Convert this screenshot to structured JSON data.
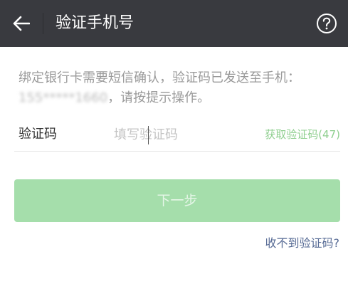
{
  "header": {
    "title": "验证手机号",
    "back_icon": "arrow-left-icon",
    "help_icon": "question-circle-icon"
  },
  "notice": {
    "text_prefix": "绑定银行卡需要短信确认，验证码已发送至手机：",
    "phone": "155*****1660",
    "text_suffix": "，请按提示操作。"
  },
  "code_field": {
    "label": "验证码",
    "placeholder": "填写验证码",
    "value": "",
    "resend_label": "获取验证码(47)"
  },
  "actions": {
    "next_label": "下一步",
    "no_code_label": "收不到验证码?"
  },
  "colors": {
    "header_bg": "#393a3f",
    "primary_disabled": "#a5deab",
    "link": "#576b95",
    "resend": "#8fcf8f"
  }
}
